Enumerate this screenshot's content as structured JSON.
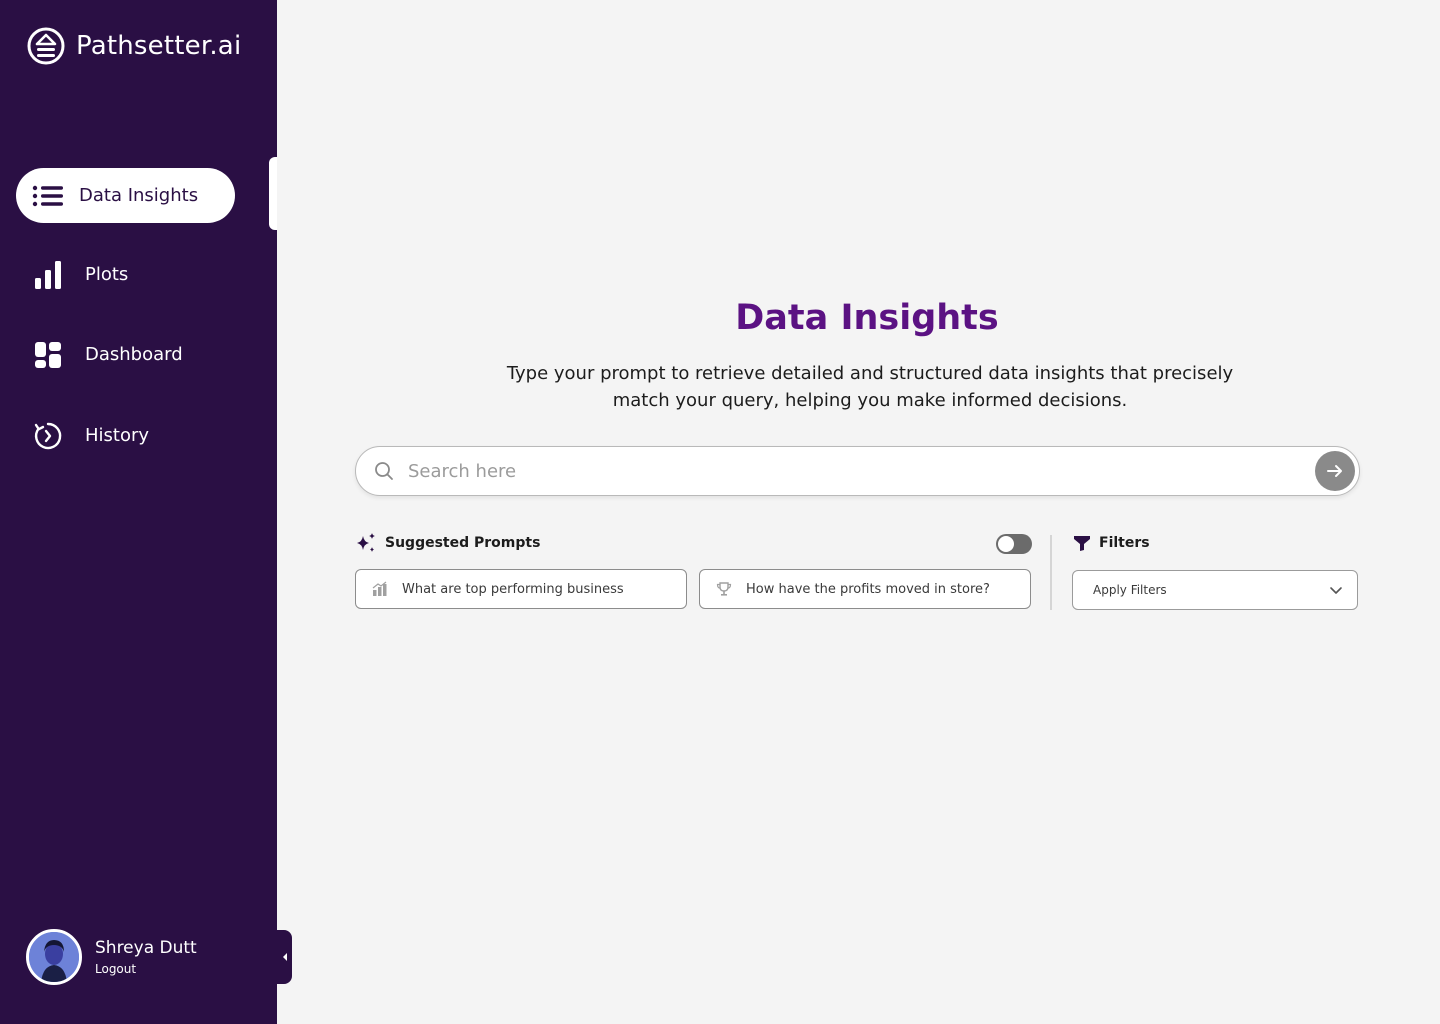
{
  "brand": {
    "name": "Pathsetter.ai"
  },
  "colors": {
    "sidebar_bg": "#2a0f44",
    "accent": "#5b1283",
    "page_bg": "#f4f4f4"
  },
  "nav": {
    "items": [
      {
        "label": "Data Insights",
        "icon": "list-icon",
        "active": true
      },
      {
        "label": "Plots",
        "icon": "bar-chart-icon",
        "active": false
      },
      {
        "label": "Dashboard",
        "icon": "grid-icon",
        "active": false
      },
      {
        "label": "History",
        "icon": "history-icon",
        "active": false
      }
    ]
  },
  "user": {
    "name": "Shreya Dutt",
    "logout_label": "Logout"
  },
  "main": {
    "title": "Data Insights",
    "subtitle": "Type your prompt to retrieve detailed and structured data insights that precisely match your query, helping you make informed decisions."
  },
  "search": {
    "placeholder": "Search here",
    "value": ""
  },
  "suggested": {
    "label": "Suggested Prompts",
    "toggle_on": false,
    "prompts": [
      {
        "text": "What are top performing business",
        "icon": "chart-icon"
      },
      {
        "text": "How have the profits moved in store?",
        "icon": "trophy-icon"
      }
    ]
  },
  "filters": {
    "label": "Filters",
    "select_value": "Apply Filters"
  }
}
